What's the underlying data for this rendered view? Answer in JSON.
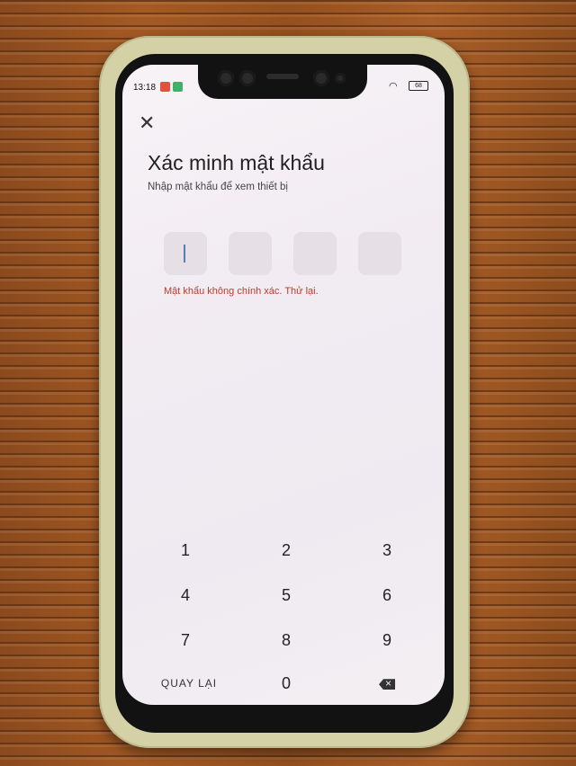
{
  "status_bar": {
    "time": "13:18",
    "battery": "68"
  },
  "header": {
    "close_glyph": "✕",
    "title": "Xác minh mật khẩu",
    "subtitle": "Nhập mật khẩu để xem thiết bị"
  },
  "pin": {
    "length": 4,
    "entered": 0
  },
  "error_message": "Mật khẩu không chính xác. Thử lại.",
  "keypad": {
    "keys": [
      "1",
      "2",
      "3",
      "4",
      "5",
      "6",
      "7",
      "8",
      "9"
    ],
    "back_label": "QUAY LẠI",
    "zero": "0",
    "delete_icon": "backspace-icon"
  },
  "colors": {
    "error": "#c0392b",
    "cursor": "#5a7fb8",
    "case": "#d4d1a7"
  }
}
